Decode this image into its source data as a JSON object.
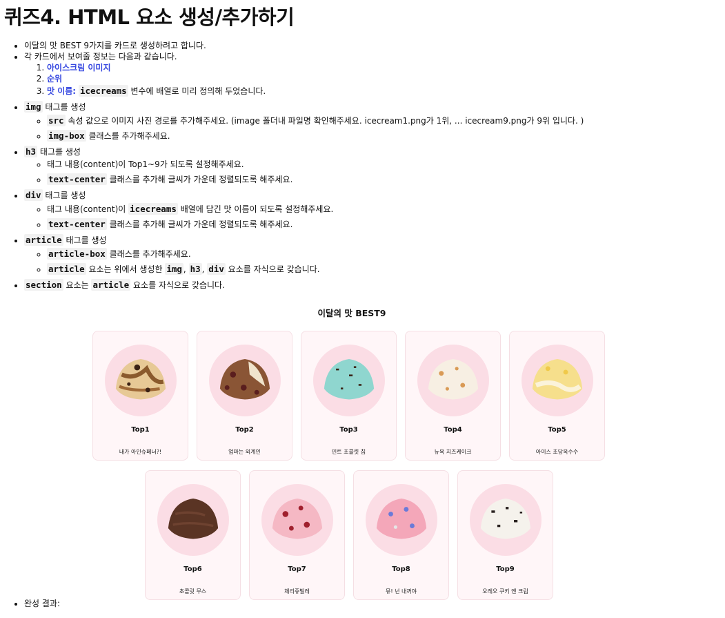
{
  "page_title": "퀴즈4. HTML 요소 생성/추가하기",
  "instructions": {
    "intro": "이달의 맛 BEST 9가지를 카드로 생성하려고 합니다.",
    "card_info": "각 카드에서 보여줄 정보는 다음과 같습니다.",
    "info_items": {
      "image": "아이스크림 이미지",
      "rank": "순위",
      "name_label": "맛 이름:",
      "name_code": "icecreams",
      "name_rest": "변수에 배열로 미리 정의해 두었습니다."
    },
    "img": {
      "tag": "img",
      "text": "태그를 생성",
      "src_code": "src",
      "src_text": "속성 값으로 이미지 사진 경로를 추가해주세요. (image 폴더내 파일명 확인해주세요. icecream1.png가 1위, ... icecream9.png가 9위 입니다. )",
      "class_code": "img-box",
      "class_text": "클래스를 추가해주세요."
    },
    "h3": {
      "tag": "h3",
      "text": "태그를 생성",
      "content_text": "태그 내용(content)이 Top1~9가 되도록 설정해주세요.",
      "class_code": "text-center",
      "class_text": "클래스를 추가해 글씨가 가운데 정렬되도록 해주세요."
    },
    "div": {
      "tag": "div",
      "text": "태그를 생성",
      "content_pre": "태그 내용(content)이",
      "content_code": "icecreams",
      "content_post": "배열에 담긴 맛 이름이 되도록 설정해주세요.",
      "class_code": "text-center",
      "class_text": "클래스를 추가해 글씨가 가운데 정렬되도록 해주세요."
    },
    "article": {
      "tag": "article",
      "text": "태그를 생성",
      "class_code": "article-box",
      "class_text": "클래스를 추가해주세요.",
      "child_code": "article",
      "child_text": "요소는 위에서 생성한",
      "c1": "img",
      "c2": "h3",
      "c3": "div",
      "child_end": "요소를 자식으로 갖습니다."
    },
    "section": {
      "code": "section",
      "text1": "요소는",
      "code2": "article",
      "text2": "요소를 자식으로 갖습니다."
    }
  },
  "result": {
    "title": "이달의 맛 BEST9",
    "cards": [
      {
        "rank": "Top1",
        "name": "내가 아인슈페너?!"
      },
      {
        "rank": "Top2",
        "name": "엄마는 외계인"
      },
      {
        "rank": "Top3",
        "name": "민트 초콜릿 칩"
      },
      {
        "rank": "Top4",
        "name": "뉴욕 치즈케이크"
      },
      {
        "rank": "Top5",
        "name": "아이스 초당옥수수"
      },
      {
        "rank": "Top6",
        "name": "초콜릿 무스"
      },
      {
        "rank": "Top7",
        "name": "체리쥬빌레"
      },
      {
        "rank": "Top8",
        "name": "뮤! 넌 내꺼야"
      },
      {
        "rank": "Top9",
        "name": "오레오 쿠키 앤 크림"
      }
    ]
  },
  "final_label": "완성 결과:",
  "colors": {
    "accent": "#3547e0",
    "card_bg": "#fff6f8",
    "circle_bg": "#fbdde5"
  }
}
